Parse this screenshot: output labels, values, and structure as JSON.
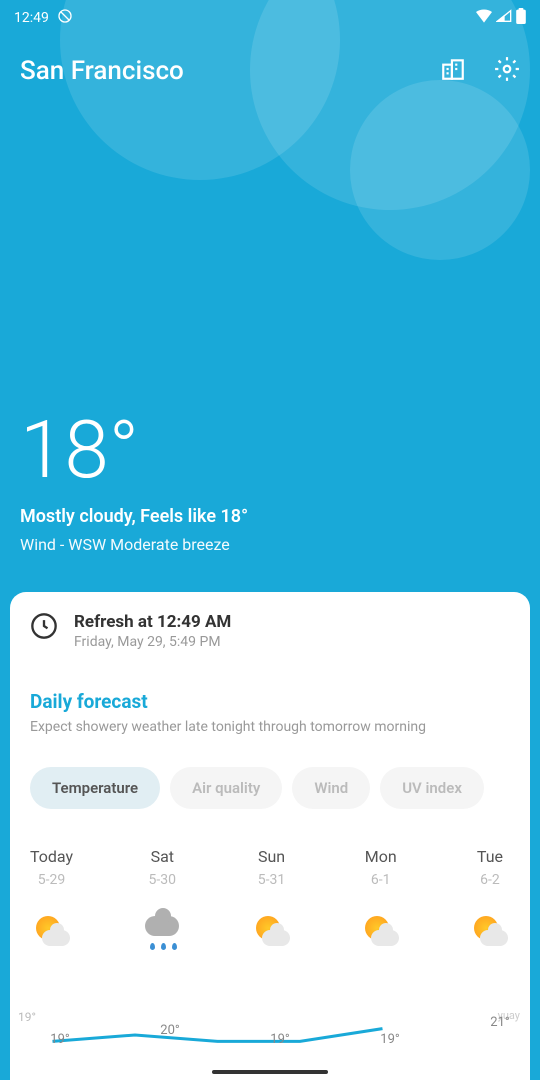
{
  "status": {
    "time": "12:49"
  },
  "header": {
    "city": "San Francisco"
  },
  "current": {
    "temp": "18°",
    "description": "Mostly cloudy, Feels like 18°",
    "wind": "Wind - WSW Moderate breeze"
  },
  "refresh": {
    "title": "Refresh at 12:49 AM",
    "subtitle": "Friday, May 29, 5:49 PM"
  },
  "forecast": {
    "title": "Daily forecast",
    "subtitle": "Expect showery weather late tonight through tomorrow morning"
  },
  "tabs": [
    {
      "label": "Temperature",
      "active": true
    },
    {
      "label": "Air quality",
      "active": false
    },
    {
      "label": "Wind",
      "active": false
    },
    {
      "label": "UV index",
      "active": false
    }
  ],
  "days": [
    {
      "name": "Today",
      "date": "5-29",
      "icon": "sun-cloud"
    },
    {
      "name": "Sat",
      "date": "5-30",
      "icon": "rain-cloud"
    },
    {
      "name": "Sun",
      "date": "5-31",
      "icon": "sun-cloud"
    },
    {
      "name": "Mon",
      "date": "6-1",
      "icon": "sun-cloud"
    },
    {
      "name": "Tue",
      "date": "6-2",
      "icon": "sun-cloud"
    }
  ],
  "chart_data": {
    "type": "line",
    "title": "",
    "xlabel": "",
    "ylabel": "",
    "ylim": [
      18,
      22
    ],
    "categories": [
      "Today",
      "Sat",
      "Sun",
      "Mon",
      "Tue"
    ],
    "values": [
      19,
      20,
      19,
      19,
      21
    ],
    "axis_left_label": "19°",
    "watermark": "yuay"
  }
}
